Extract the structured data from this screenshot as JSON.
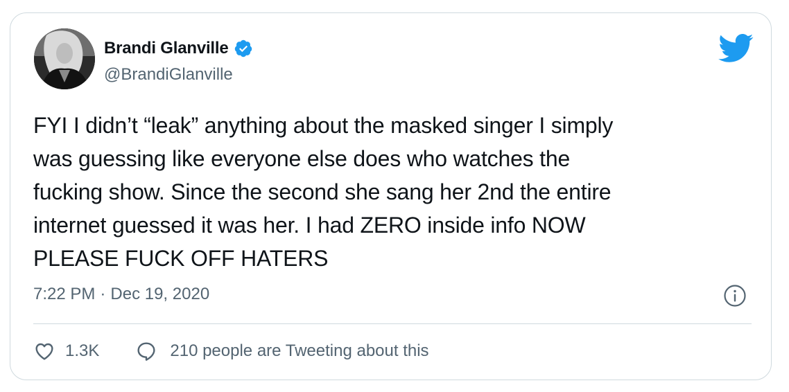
{
  "author": {
    "display_name": "Brandi Glanville",
    "handle": "@BrandiGlanville",
    "verified": true
  },
  "tweet": {
    "text": "FYI I didn’t “leak” anything about the masked singer I simply\nwas guessing like everyone else does who watches the\nfucking show. Since the second she sang  her 2nd the entire\ninternet guessed it was her. I had ZERO inside info NOW\nPLEASE FUCK OFF HATERS",
    "time": "7:22 PM",
    "separator": "·",
    "date": "Dec 19, 2020"
  },
  "engagement": {
    "likes": "1.3K",
    "tweeting_label": "210 people are Tweeting about this"
  },
  "icons": {
    "verified": "verified-badge-icon",
    "brand": "twitter-bird-icon",
    "info": "info-icon",
    "like": "heart-icon",
    "reply": "speech-bubble-icon"
  },
  "colors": {
    "brand_blue": "#1d9bf0",
    "text_primary": "#0f1419",
    "text_secondary": "#536471",
    "border": "#cfd9de"
  }
}
